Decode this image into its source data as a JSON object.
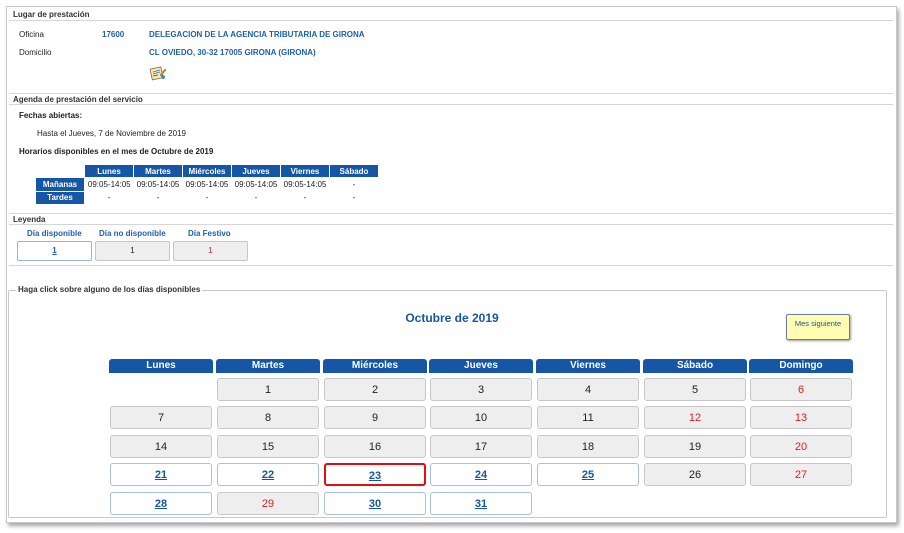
{
  "lugar": {
    "section_title": "Lugar de prestación",
    "oficina_label": "Oficina",
    "oficina_code": "17600",
    "oficina_name": "DELEGACION DE LA AGENCIA TRIBUTARIA DE GIRONA",
    "domicilio_label": "Domicilio",
    "domicilio_value": "CL OVIEDO, 30-32 17005 GIRONA (GIRONA)",
    "map_icon": "map-document-icon"
  },
  "agenda": {
    "section_title": "Agenda de prestación del servicio",
    "fechas_label": "Fechas abiertas:",
    "fechas_value": "Hasta el Jueves, 7 de Noviembre de 2019",
    "horarios_title": "Horarios disponibles en el mes de Octubre de 2019",
    "days": [
      "Lunes",
      "Martes",
      "Miércoles",
      "Jueves",
      "Viernes",
      "Sábado"
    ],
    "rows": [
      {
        "label": "Mañanas",
        "values": [
          "09:05-14:05",
          "09:05-14:05",
          "09:05-14:05",
          "09:05-14:05",
          "09:05-14:05",
          "-"
        ]
      },
      {
        "label": "Tardes",
        "values": [
          "-",
          "-",
          "-",
          "-",
          "-",
          "-"
        ]
      }
    ]
  },
  "leyenda": {
    "section_title": "Leyenda",
    "items": [
      {
        "title": "Día disponible",
        "sample": "1"
      },
      {
        "title": "Día no disponible",
        "sample": "1"
      },
      {
        "title": "Día Festivo",
        "sample": "1"
      }
    ]
  },
  "calendar": {
    "instruction": "Haga click sobre alguno de los días disponibles",
    "month_title": "Octubre de 2019",
    "next_button": "Mes siguiente",
    "colors": {
      "header": "#1556a6",
      "available": "#1556a6",
      "holiday": "#e02020",
      "selected_border": "#e01010"
    },
    "weekdays": [
      "Lunes",
      "Martes",
      "Miércoles",
      "Jueves",
      "Viernes",
      "Sábado",
      "Domingo"
    ],
    "days": [
      {
        "d": "1",
        "col": 1,
        "row": 0,
        "state": "nd"
      },
      {
        "d": "2",
        "col": 2,
        "row": 0,
        "state": "nd"
      },
      {
        "d": "3",
        "col": 3,
        "row": 0,
        "state": "nd"
      },
      {
        "d": "4",
        "col": 4,
        "row": 0,
        "state": "nd"
      },
      {
        "d": "5",
        "col": 5,
        "row": 0,
        "state": "nd"
      },
      {
        "d": "6",
        "col": 6,
        "row": 0,
        "state": "fest"
      },
      {
        "d": "7",
        "col": 0,
        "row": 1,
        "state": "nd"
      },
      {
        "d": "8",
        "col": 1,
        "row": 1,
        "state": "nd"
      },
      {
        "d": "9",
        "col": 2,
        "row": 1,
        "state": "nd"
      },
      {
        "d": "10",
        "col": 3,
        "row": 1,
        "state": "nd"
      },
      {
        "d": "11",
        "col": 4,
        "row": 1,
        "state": "nd"
      },
      {
        "d": "12",
        "col": 5,
        "row": 1,
        "state": "fest"
      },
      {
        "d": "13",
        "col": 6,
        "row": 1,
        "state": "fest"
      },
      {
        "d": "14",
        "col": 0,
        "row": 2,
        "state": "nd"
      },
      {
        "d": "15",
        "col": 1,
        "row": 2,
        "state": "nd"
      },
      {
        "d": "16",
        "col": 2,
        "row": 2,
        "state": "nd"
      },
      {
        "d": "17",
        "col": 3,
        "row": 2,
        "state": "nd"
      },
      {
        "d": "18",
        "col": 4,
        "row": 2,
        "state": "nd"
      },
      {
        "d": "19",
        "col": 5,
        "row": 2,
        "state": "nd"
      },
      {
        "d": "20",
        "col": 6,
        "row": 2,
        "state": "fest"
      },
      {
        "d": "21",
        "col": 0,
        "row": 3,
        "state": "disp"
      },
      {
        "d": "22",
        "col": 1,
        "row": 3,
        "state": "disp"
      },
      {
        "d": "23",
        "col": 2,
        "row": 3,
        "state": "disp",
        "selected": true
      },
      {
        "d": "24",
        "col": 3,
        "row": 3,
        "state": "disp"
      },
      {
        "d": "25",
        "col": 4,
        "row": 3,
        "state": "disp"
      },
      {
        "d": "26",
        "col": 5,
        "row": 3,
        "state": "nd"
      },
      {
        "d": "27",
        "col": 6,
        "row": 3,
        "state": "fest"
      },
      {
        "d": "28",
        "col": 0,
        "row": 4,
        "state": "disp"
      },
      {
        "d": "29",
        "col": 1,
        "row": 4,
        "state": "fest"
      },
      {
        "d": "30",
        "col": 2,
        "row": 4,
        "state": "disp"
      },
      {
        "d": "31",
        "col": 3,
        "row": 4,
        "state": "disp"
      }
    ]
  }
}
